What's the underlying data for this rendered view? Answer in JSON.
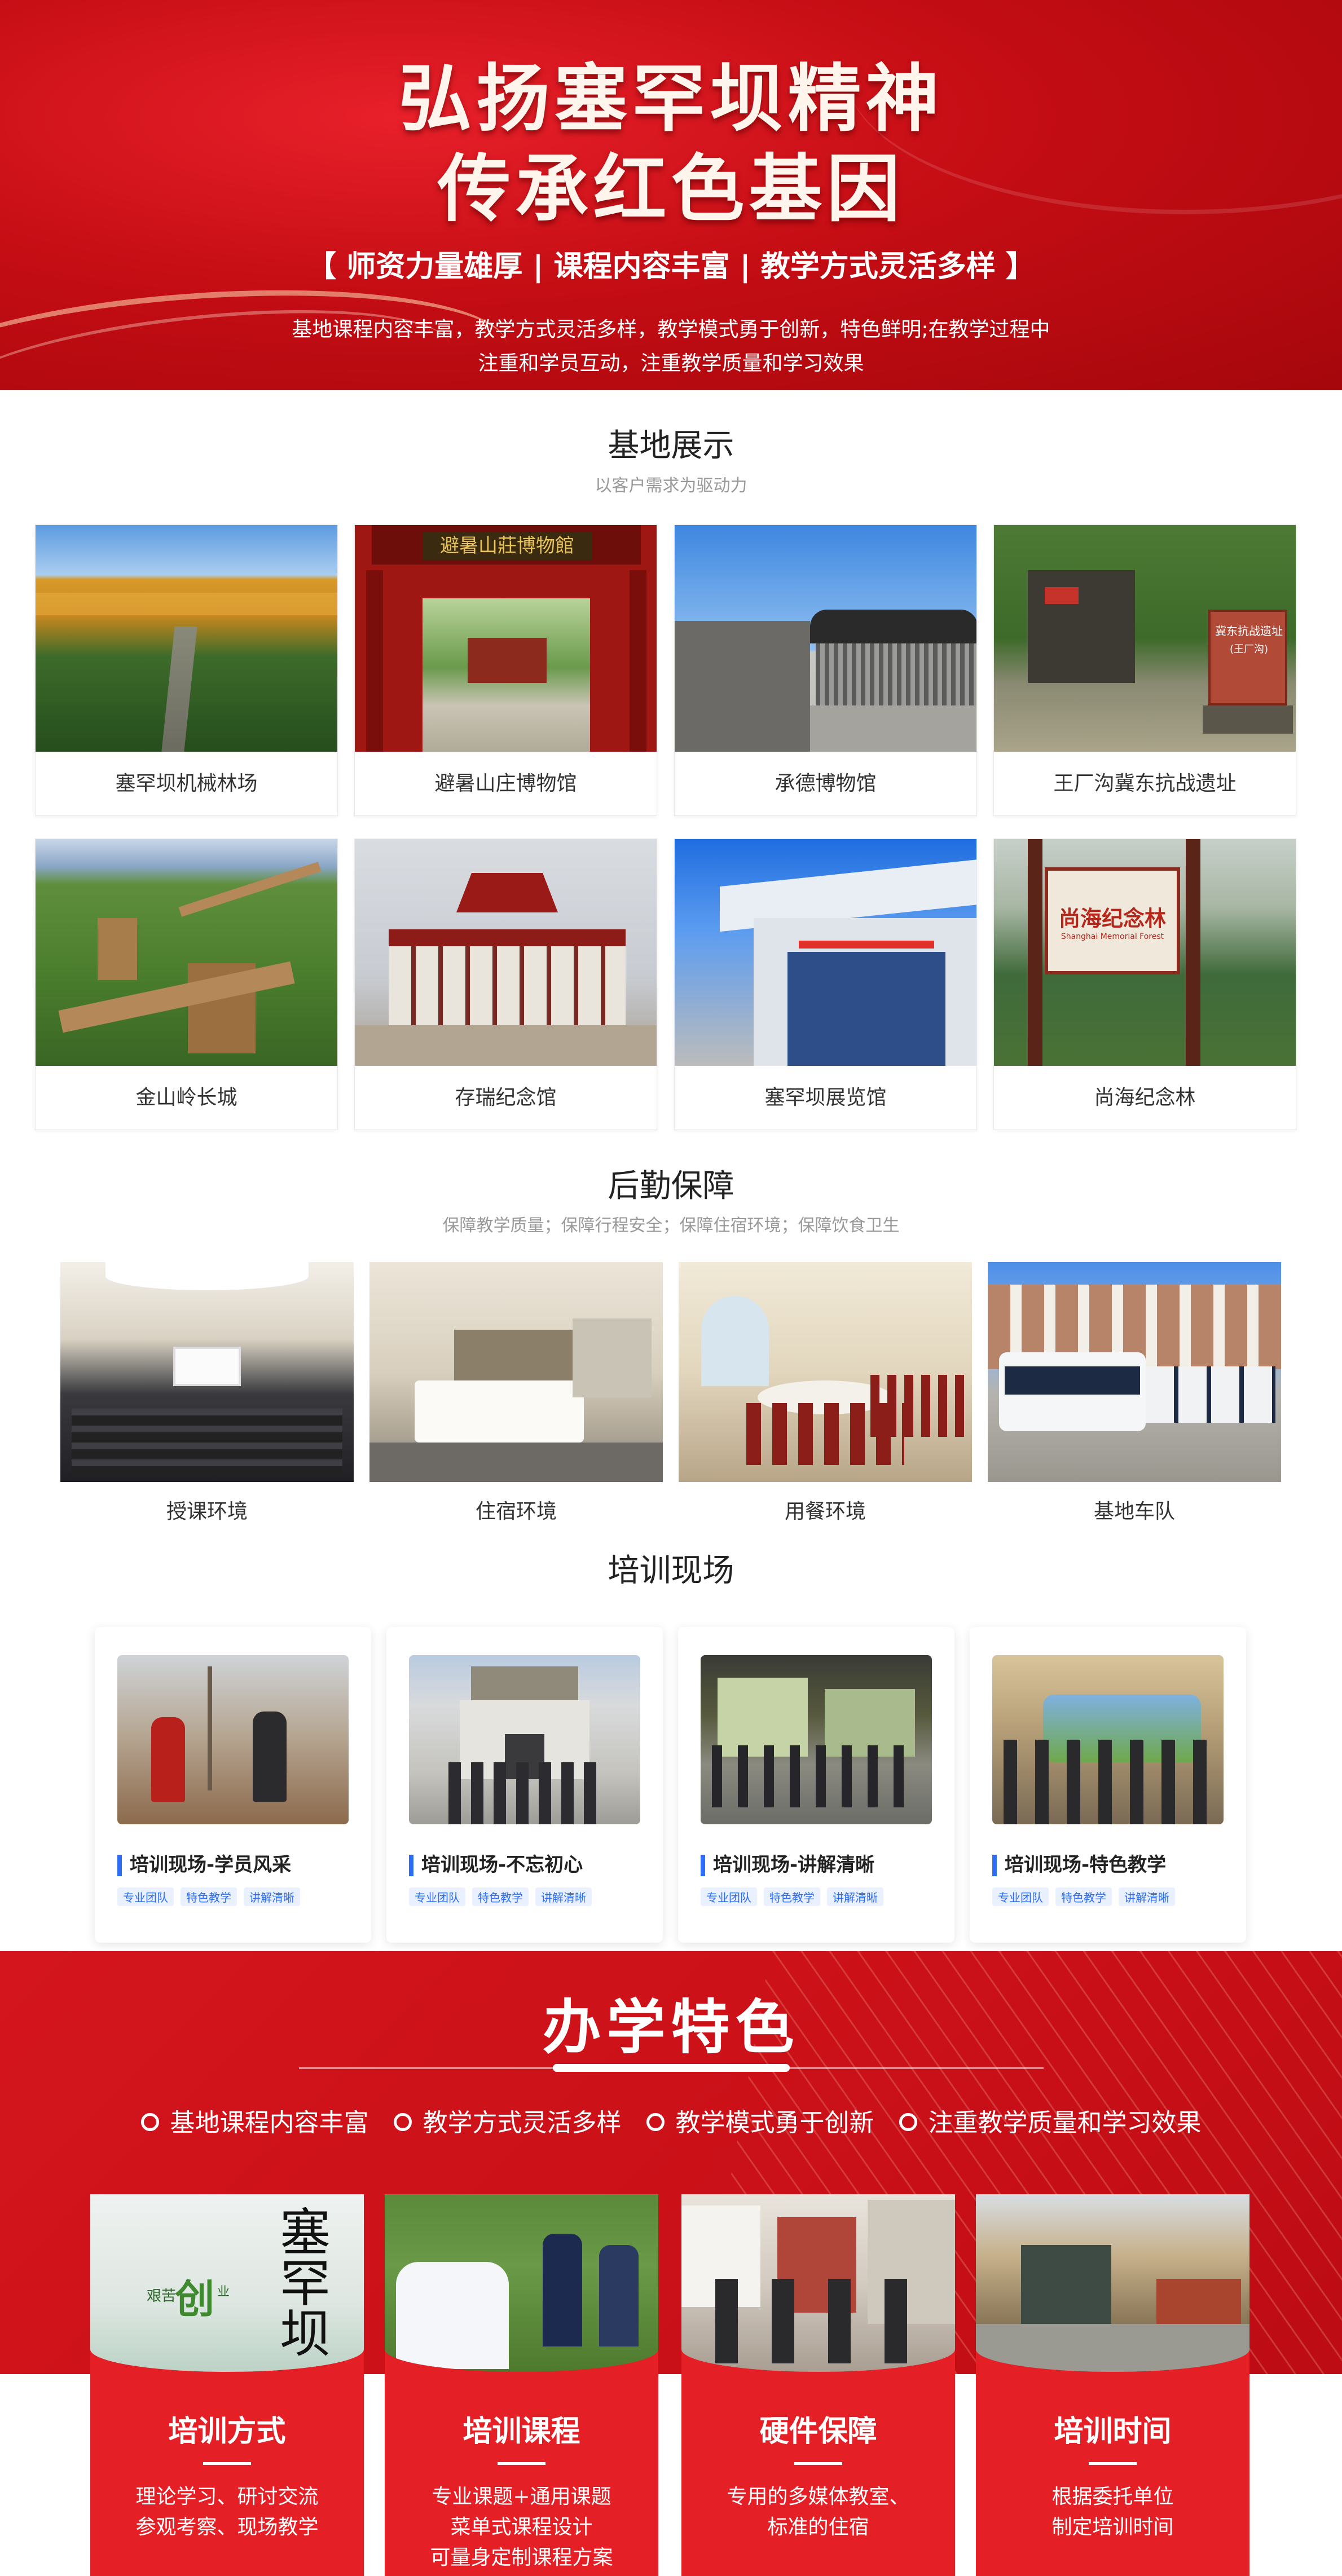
{
  "hero": {
    "title_line1": "弘扬塞罕坝精神",
    "title_line2": "传承红色基因",
    "tagline": "【 师资力量雄厚 | 课程内容丰富 | 教学方式灵活多样 】",
    "desc_line1": "基地课程内容丰富，教学方式灵活多样，教学模式勇于创新，特色鲜明;在教学过程中",
    "desc_line2": "注重和学员互动，注重教学质量和学习效果"
  },
  "base": {
    "title": "基地展示",
    "subtitle": "以客户需求为驱动力",
    "items": [
      {
        "label": "塞罕坝机械林场"
      },
      {
        "label": "避暑山庄博物馆"
      },
      {
        "label": "承德博物馆"
      },
      {
        "label": "王厂沟冀东抗战遗址"
      },
      {
        "label": "金山岭长城"
      },
      {
        "label": "存瑞纪念馆"
      },
      {
        "label": "塞罕坝展览馆"
      },
      {
        "label": "尚海纪念林"
      }
    ],
    "sign_text": {
      "museum_plaque": "避暑山莊博物館",
      "ruin_plaque": "冀东抗战遗址",
      "ruin_sub": "(王厂沟)",
      "forest_sign": "尚海纪念林",
      "forest_sign_en": "Shanghai Memorial Forest"
    }
  },
  "logistics": {
    "title": "后勤保障",
    "subtitle": "保障教学质量；保障行程安全；保障住宿环境；保障饮食卫生",
    "items": [
      {
        "label": "授课环境"
      },
      {
        "label": "住宿环境"
      },
      {
        "label": "用餐环境"
      },
      {
        "label": "基地车队"
      }
    ]
  },
  "training": {
    "title": "培训现场",
    "items": [
      {
        "label": "培训现场-学员风采",
        "tags": [
          "专业团队",
          "特色教学",
          "讲解清晰"
        ]
      },
      {
        "label": "培训现场-不忘初心",
        "tags": [
          "专业团队",
          "特色教学",
          "讲解清晰"
        ]
      },
      {
        "label": "培训现场-讲解清晰",
        "tags": [
          "专业团队",
          "特色教学",
          "讲解清晰"
        ]
      },
      {
        "label": "培训现场-特色教学",
        "tags": [
          "专业团队",
          "特色教学",
          "讲解清晰"
        ]
      }
    ]
  },
  "features": {
    "title": "办学特色",
    "points": [
      "基地课程内容丰富",
      "教学方式灵活多样",
      "教学模式勇于创新",
      "注重教学质量和学习效果"
    ],
    "cards": [
      {
        "title": "培训方式",
        "lines": [
          "理论学习、研讨交流",
          "参观考察、现场教学"
        ]
      },
      {
        "title": "培训课程",
        "lines": [
          "专业课题+通用课题",
          "菜单式课程设计",
          "可量身定制课程方案"
        ]
      },
      {
        "title": "硬件保障",
        "lines": [
          "专用的多媒体教室、",
          "标准的住宿"
        ]
      },
      {
        "title": "培训时间",
        "lines": [
          "根据委托单位",
          "制定培训时间"
        ]
      }
    ],
    "poster_text": {
      "big": "塞罕坝",
      "green": "创",
      "small1": "艰苦",
      "small2": "业"
    }
  },
  "colors": {
    "brand_red": "#c50d14",
    "accent_blue": "#2d6df6",
    "card_red": "#e41f26"
  }
}
